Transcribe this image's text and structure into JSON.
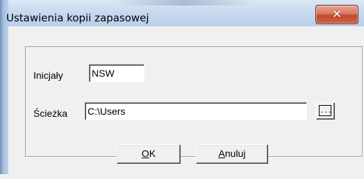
{
  "window": {
    "title": "Ustawienia kopii zapasowej",
    "close_glyph": "✕"
  },
  "form": {
    "initials_label": "Inicjały",
    "initials_value": "NSW",
    "path_label": "Ścieżka",
    "path_value": "C:\\Users",
    "browse_label": "..."
  },
  "buttons": {
    "ok_mnemonic": "O",
    "ok_rest": "K",
    "cancel_mnemonic": "A",
    "cancel_rest": "nuluj"
  },
  "colors": {
    "client_bg": "#f0f0f0",
    "close_button": "#c3482b"
  }
}
